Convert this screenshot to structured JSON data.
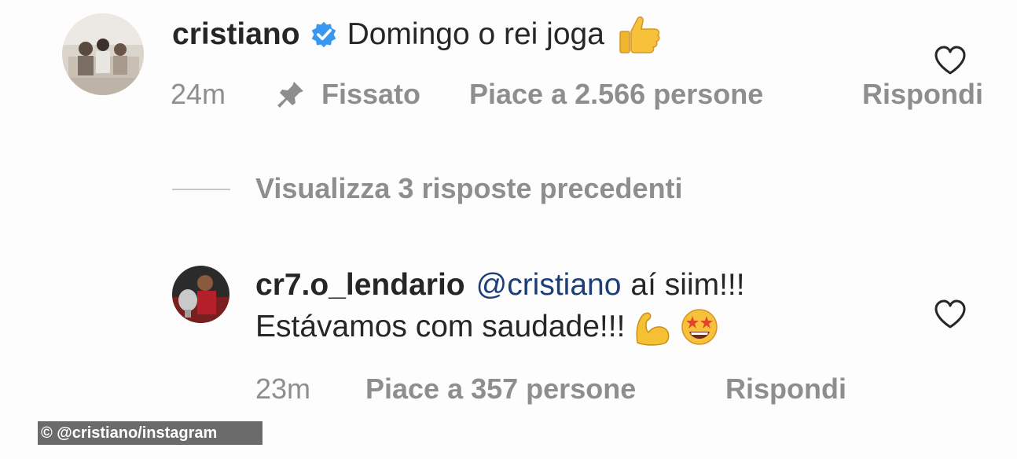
{
  "comment": {
    "username": "cristiano",
    "verified_icon": "verified-badge-icon",
    "text": "Domingo o rei joga",
    "emoji": "thumbs-up-emoji",
    "time": "24m",
    "pinned_label": "Fissato",
    "likes": "Piace a 2.566 persone",
    "reply_label": "Rispondi"
  },
  "view_replies": "Visualizza 3 risposte precedenti",
  "reply": {
    "username": "cr7.o_lendario",
    "mention": "@cristiano",
    "text_line1": "aí siim!!!",
    "text_line2": "Estávamos com saudade!!!",
    "emojis": [
      "flexed-biceps-emoji",
      "star-struck-emoji"
    ],
    "time": "23m",
    "likes": "Piace a 357 persone",
    "reply_label": "Rispondi"
  },
  "credit": "© @cristiano/instagram",
  "colors": {
    "text": "#262626",
    "meta": "#8e8e8e",
    "verified": "#3897f0",
    "mention": "#1c3f7a",
    "credit_bg": "#6b6b6b"
  }
}
